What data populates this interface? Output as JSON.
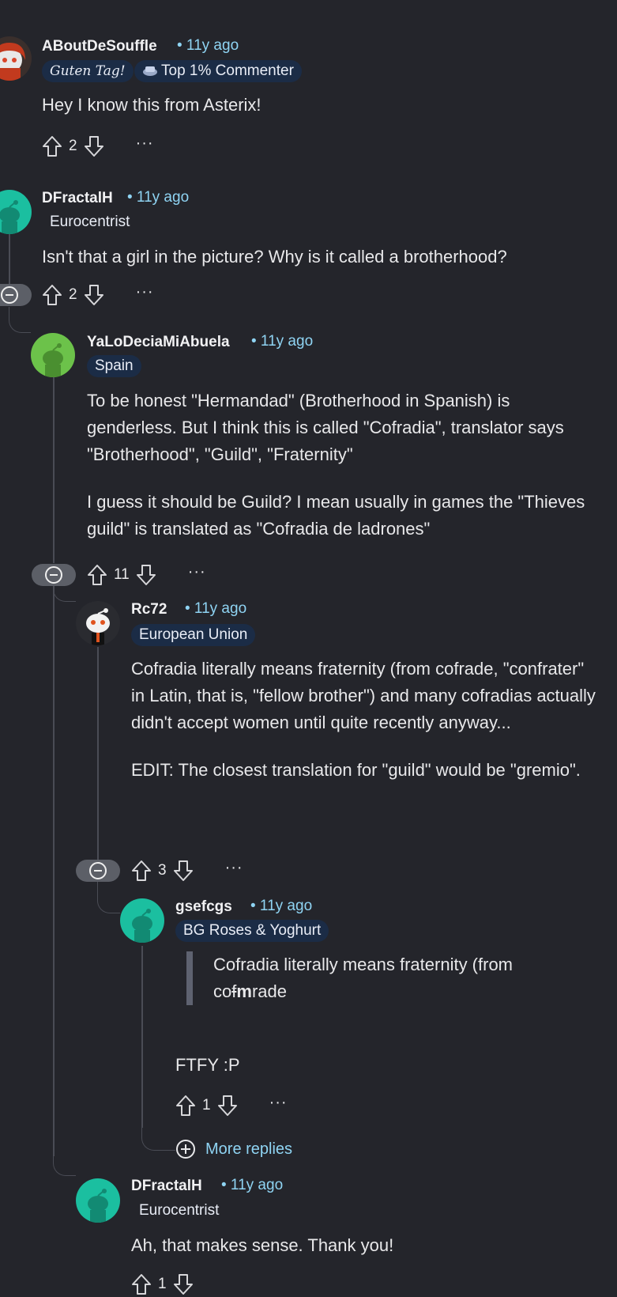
{
  "comments": {
    "c1": {
      "author": "ABoutDeSouffle",
      "time": "• 11y ago",
      "flair1": "Guten Tag!",
      "flair2": "Top 1% Commenter",
      "body": "Hey I know this from Asterix!",
      "score": "2"
    },
    "c2": {
      "author": "DFractalH",
      "time": "• 11y ago",
      "flair": "Eurocentrist",
      "body": "Isn't that a girl in the picture? Why is it called a brotherhood?",
      "score": "2"
    },
    "c3": {
      "author": "YaLoDeciaMiAbuela",
      "time": "• 11y ago",
      "flair": "Spain",
      "body_p1": "To be honest \"Hermandad\" (Brotherhood in Spanish) is genderless. But I think this is called \"Cofradia\", translator says \"Brotherhood\", \"Guild\", \"Fraternity\"",
      "body_p2": "I guess it should be Guild? I mean usually in games the \"Thieves guild\" is translated as \"Cofradia de ladrones\"",
      "score": "11"
    },
    "c4": {
      "author": "Rc72",
      "time": "• 11y ago",
      "flair": "European Union",
      "body_p1": "Cofradia literally means fraternity (from cofrade, \"confrater\" in Latin, that is, \"fellow brother\") and many cofradias actually didn't accept women until quite recently anyway...",
      "body_p2": "EDIT: The closest translation for \"guild\" would be \"gremio\".",
      "score": "3"
    },
    "c5": {
      "author": "gsefcgs",
      "time": "• 11y ago",
      "flair": "BG Roses & Yoghurt",
      "quote_text": "Cofradia literally means fraternity (from co",
      "quote_struck": "f",
      "quote_bold": "m",
      "quote_rest": "rade",
      "body": "FTFY :P",
      "score": "1"
    },
    "more_replies": "More replies",
    "c6": {
      "author": "DFractalH",
      "time": "• 11y ago",
      "flair": "Eurocentrist",
      "body": "Ah, that makes sense. Thank you!",
      "score": "1"
    }
  },
  "colors": {
    "background": "#24252b",
    "link_blue": "#8fd4f3",
    "flair_bg": "#1b2c46",
    "thread_line": "#4a4c55",
    "avatar_teal": "#1bbfa0",
    "avatar_green": "#6cc24a"
  },
  "icons": [
    "upvote-icon",
    "downvote-icon",
    "overflow-icon",
    "collapse-icon",
    "add-circle-icon",
    "snoo-avatar-icon"
  ]
}
